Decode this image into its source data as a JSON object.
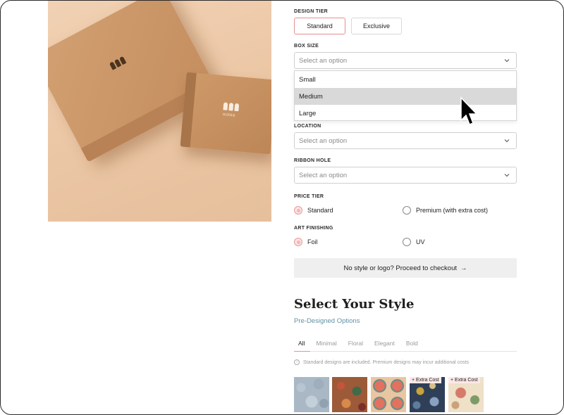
{
  "product": {
    "image_alt": "Kraft paper boxes",
    "brand_word": "mikke"
  },
  "design_tier": {
    "label": "DESIGN TIER",
    "options": [
      "Standard",
      "Exclusive"
    ],
    "selected": "Standard"
  },
  "box_size": {
    "label": "BOX SIZE",
    "placeholder": "Select an option",
    "options": [
      "Small",
      "Medium",
      "Large"
    ],
    "highlighted": "Medium"
  },
  "location": {
    "label": "LOCATION",
    "placeholder": "Select an option"
  },
  "ribbon_hole": {
    "label": "RIBBON HOLE",
    "placeholder": "Select an option"
  },
  "price_tier": {
    "label": "PRICE TIER",
    "options": [
      "Standard",
      "Premium (with extra cost)"
    ],
    "selected": "Standard"
  },
  "art_finishing": {
    "label": "ART FINISHING",
    "options": [
      "Foil",
      "UV"
    ],
    "selected": "Foil"
  },
  "checkout": {
    "label": "No style or logo? Proceed to checkout",
    "arrow": "→"
  },
  "styles": {
    "heading": "Select Your Style",
    "subheading": "Pre-Designed Options",
    "tabs": [
      "All",
      "Minimal",
      "Floral",
      "Elegant",
      "Bold"
    ],
    "active_tab": "All",
    "note": "Standard designs are included. Premium designs may incur additional costs",
    "swatch_badge": "+ Extra Cost"
  },
  "colors": {
    "accent_pink": "#e88f8f",
    "link_teal": "#5f93a3",
    "dropdown_highlight": "#d9d9d9"
  }
}
